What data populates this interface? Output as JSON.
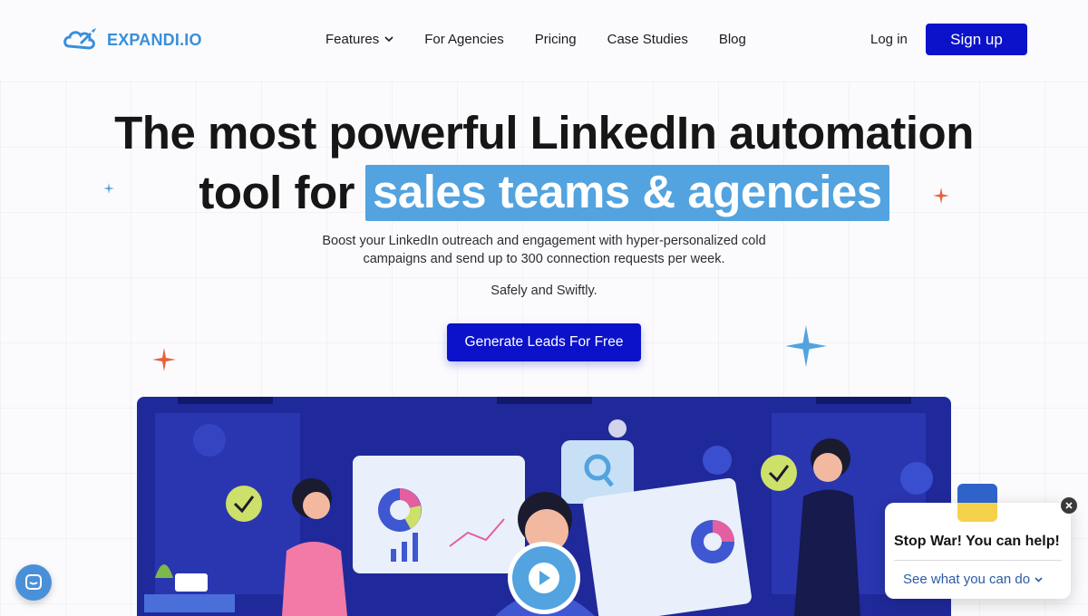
{
  "header": {
    "logo_text": "EXPANDI.IO",
    "nav": [
      {
        "label": "Features",
        "has_dropdown": true
      },
      {
        "label": "For Agencies"
      },
      {
        "label": "Pricing"
      },
      {
        "label": "Case Studies"
      },
      {
        "label": "Blog"
      }
    ],
    "login_label": "Log in",
    "signup_label": "Sign up"
  },
  "hero": {
    "title_line1": "The most powerful LinkedIn automation",
    "title_line2_prefix": "tool for",
    "title_highlight": "sales teams & agencies",
    "subtitle": "Boost your LinkedIn outreach and engagement with hyper-personalized cold campaigns and send up to 300 connection requests per week.",
    "tagline": "Safely and Swiftly.",
    "cta_label": "Generate Leads For Free"
  },
  "popup": {
    "title": "Stop War! You can help!",
    "link_label": "See what you can do"
  },
  "colors": {
    "brand_blue": "#0b12c9",
    "highlight": "#52a3df",
    "logo": "#3a8fd9",
    "illustration_bg": "#20299a"
  },
  "icons": [
    "rocket-logo-icon",
    "chevron-down-icon",
    "sparkle-icon",
    "play-icon",
    "chat-icon",
    "close-icon",
    "ukraine-flag-icon"
  ]
}
